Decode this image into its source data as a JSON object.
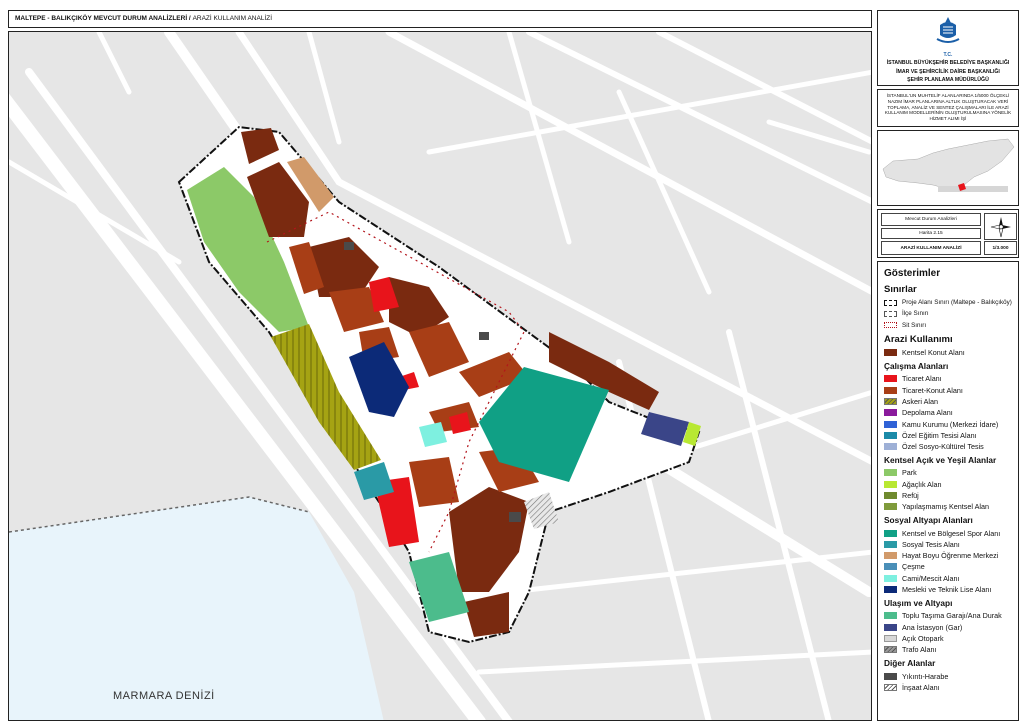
{
  "header": {
    "title": "MALTEPE - BALIKÇIKÖY MEVCUT DURUM ANALİZLERİ /",
    "subtitle": "ARAZİ KULLANIM ANALİZİ"
  },
  "institution": {
    "tc": "T.C.",
    "line1": "İSTANBUL BÜYÜKŞEHİR BELEDİYE BAŞKANLIĞI",
    "line2": "İMAR VE ŞEHİRCİLİK DAİRE BAŞKANLIĞI",
    "line3": "ŞEHİR PLANLAMA MÜDÜRLÜĞÜ"
  },
  "project": {
    "description": "İSTANBUL'UN MUHTELİF ALANLARINDA 1/5000 ÖLÇEKLİ NAZIM İMAR PLANLARINA ALTLIK OLUŞTURACAK VERİ TOPLAMA, ANALİZ VE SENTEZ ÇALIŞMALARI İLE ARAZİ KULLANIM MODELLERİNİN OLUŞTURULMASINA YÖNELİK HİZMET ALIMI İŞİ"
  },
  "map_info": {
    "section": "Mevcut Durum Analizleri",
    "map_no": "Harita 2.15",
    "map_title": "ARAZİ KULLANIM ANALİZİ",
    "scale": "1/3.000"
  },
  "map": {
    "sea_label": "MARMARA DENİZİ"
  },
  "legend": {
    "title": "Gösterimler",
    "boundaries": {
      "heading": "Sınırlar",
      "items": [
        {
          "label": "Proje Alanı Sınırı (Maltepe - Balıkçıköy)",
          "style": "dashdot-black"
        },
        {
          "label": "İlçe Sınırı",
          "style": "dashed-black"
        },
        {
          "label": "Sit Sınırı",
          "style": "dotted-red"
        }
      ]
    },
    "land_use_heading": "Arazi Kullanımı",
    "groups": [
      {
        "heading": "",
        "items": [
          {
            "label": "Kentsel Konut Alanı",
            "color": "#7a2a10"
          }
        ]
      },
      {
        "heading": "Çalışma Alanları",
        "items": [
          {
            "label": "Ticaret Alanı",
            "color": "#e8141b"
          },
          {
            "label": "Ticaret-Konut Alanı",
            "color": "#a83e16"
          },
          {
            "label": "Askeri Alan",
            "color": "#a5a313",
            "pattern": "hatch"
          },
          {
            "label": "Depolama Alanı",
            "color": "#8a1a9c"
          },
          {
            "label": "Kamu Kurumu (Merkezi İdare)",
            "color": "#2f62d6"
          },
          {
            "label": "Özel Eğitim Tesisi Alanı",
            "color": "#1b8aa8"
          },
          {
            "label": "Özel Sosyo-Kültürel Tesis",
            "color": "#9eb0d6"
          }
        ]
      },
      {
        "heading": "Kentsel Açık ve Yeşil Alanlar",
        "items": [
          {
            "label": "Park",
            "color": "#8cc968"
          },
          {
            "label": "Ağaçlık Alan",
            "color": "#b8e832"
          },
          {
            "label": "Refüj",
            "color": "#6f8a2e"
          },
          {
            "label": "Yapılaşmamış Kentsel Alan",
            "color": "#7f9b3c"
          }
        ]
      },
      {
        "heading": "Sosyal Altyapı Alanları",
        "items": [
          {
            "label": "Kentsel ve Bölgesel Spor Alanı",
            "color": "#10a085"
          },
          {
            "label": "Sosyal Tesis Alanı",
            "color": "#2a9aa6"
          },
          {
            "label": "Hayat Boyu Öğrenme Merkezi",
            "color": "#d19a6a"
          },
          {
            "label": "Çeşme",
            "color": "#4a8fb8"
          },
          {
            "label": "Cami/Mescit Alanı",
            "color": "#7ef0e0"
          },
          {
            "label": "Mesleki ve Teknik Lise Alanı",
            "color": "#0c2a78"
          }
        ]
      },
      {
        "heading": "Ulaşım ve Altyapı",
        "items": [
          {
            "label": "Toplu Taşıma Garajı/Ana Durak",
            "color": "#4cbc8c"
          },
          {
            "label": "Ana İstasyon (Gar)",
            "color": "#3a4588"
          },
          {
            "label": "Açık Otopark",
            "color": "#d8d8d8"
          },
          {
            "label": "Trafo Alanı",
            "color": "#9a9a9a",
            "pattern": "hatch"
          }
        ]
      },
      {
        "heading": "Diğer Alanlar",
        "items": [
          {
            "label": "Yıkıntı-Harabe",
            "color": "#4a4a4a"
          },
          {
            "label": "İnşaat Alanı",
            "color": "#ffffff",
            "pattern": "hatch"
          }
        ]
      }
    ]
  }
}
